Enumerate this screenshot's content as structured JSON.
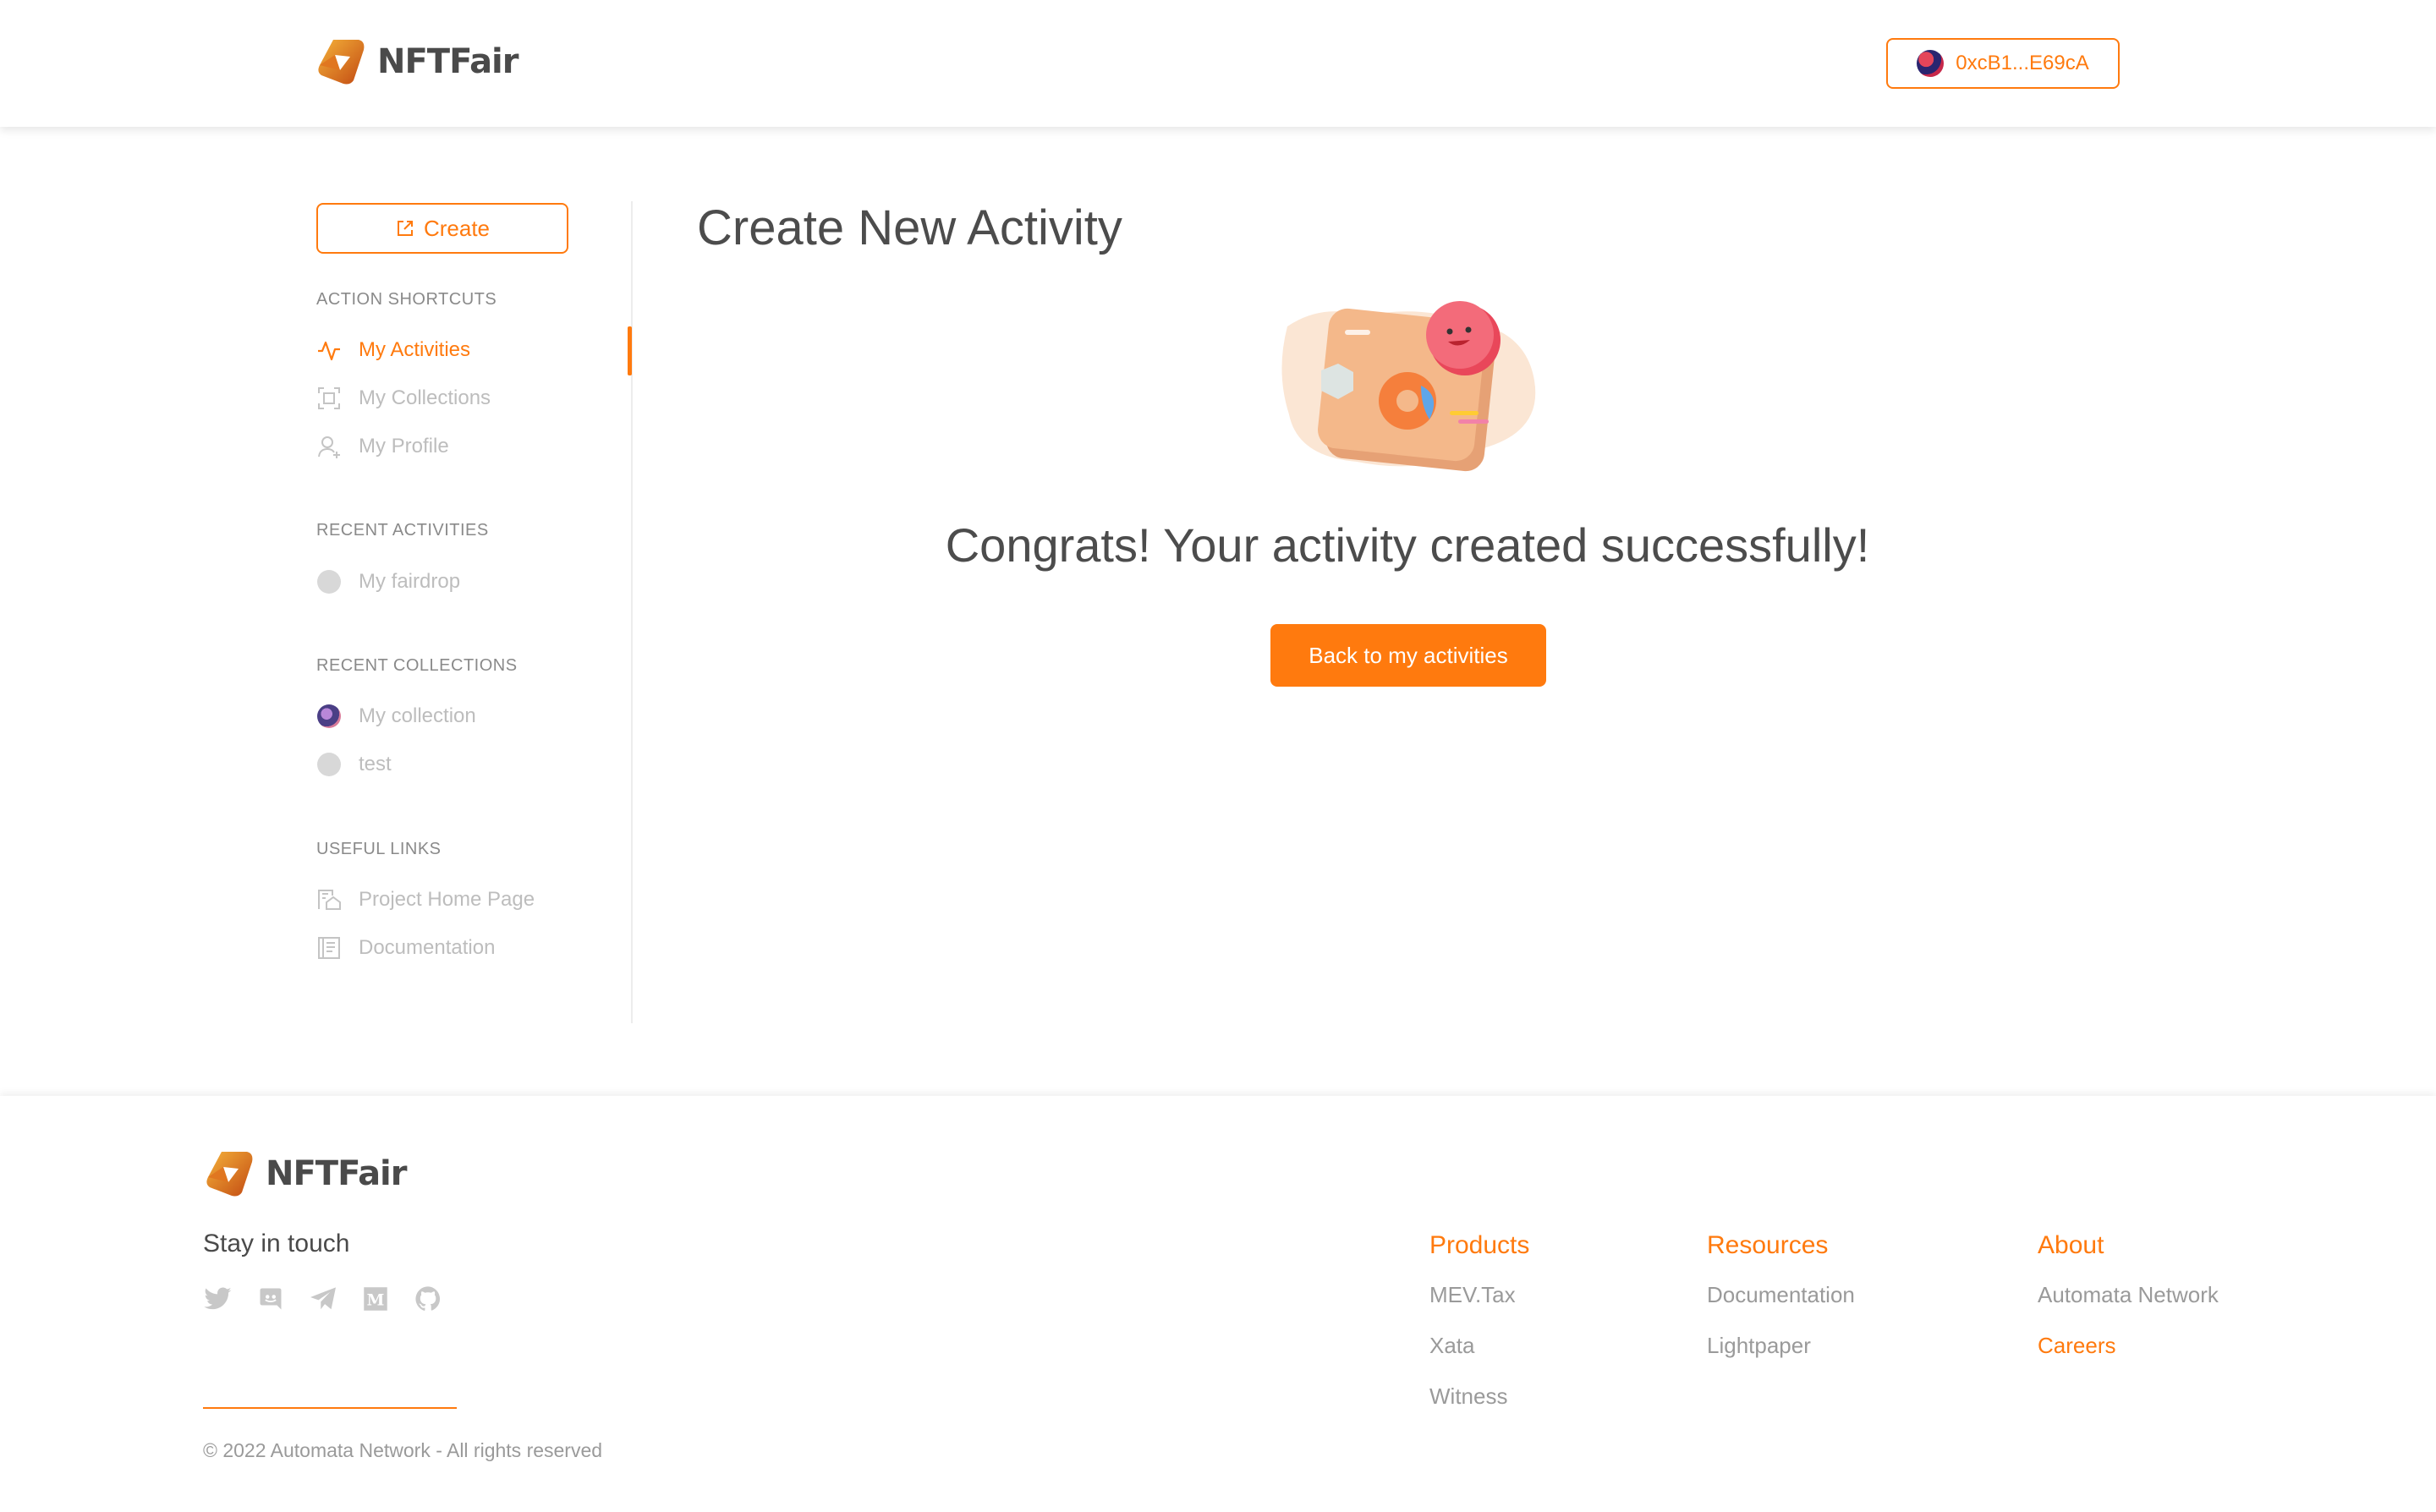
{
  "brand": {
    "name": "NFTFair",
    "accent": "#ff7a0e"
  },
  "header": {
    "wallet_address": "0xcB1...E69cA"
  },
  "sidebar": {
    "create_label": "Create",
    "sections": {
      "shortcuts_title": "ACTION SHORTCUTS",
      "recent_activities_title": "RECENT ACTIVITIES",
      "recent_collections_title": "RECENT COLLECTIONS",
      "useful_links_title": "USEFUL LINKS"
    },
    "shortcuts": [
      {
        "label": "My Activities",
        "icon": "activity-icon",
        "active": true
      },
      {
        "label": "My Collections",
        "icon": "collections-icon",
        "active": false
      },
      {
        "label": "My Profile",
        "icon": "profile-icon",
        "active": false
      }
    ],
    "recent_activities": [
      {
        "label": "My fairdrop"
      }
    ],
    "recent_collections": [
      {
        "label": "My collection"
      },
      {
        "label": "test"
      }
    ],
    "useful_links": [
      {
        "label": "Project Home Page",
        "icon": "home-page-icon"
      },
      {
        "label": "Documentation",
        "icon": "documentation-icon"
      }
    ]
  },
  "main": {
    "title": "Create New Activity",
    "message": "Congrats! Your activity created successfully!",
    "back_button": "Back to my activities"
  },
  "footer": {
    "stay_in_touch": "Stay in touch",
    "socials": [
      "twitter-icon",
      "discord-icon",
      "telegram-icon",
      "medium-icon",
      "github-icon"
    ],
    "copyright": "© 2022 Automata Network - All rights reserved",
    "columns": [
      {
        "title": "Products",
        "links": [
          "MEV.Tax",
          "Xata",
          "Witness"
        ]
      },
      {
        "title": "Resources",
        "links": [
          "Documentation",
          "Lightpaper"
        ]
      },
      {
        "title": "About",
        "links": [
          "Automata Network",
          "Careers"
        ]
      }
    ]
  }
}
